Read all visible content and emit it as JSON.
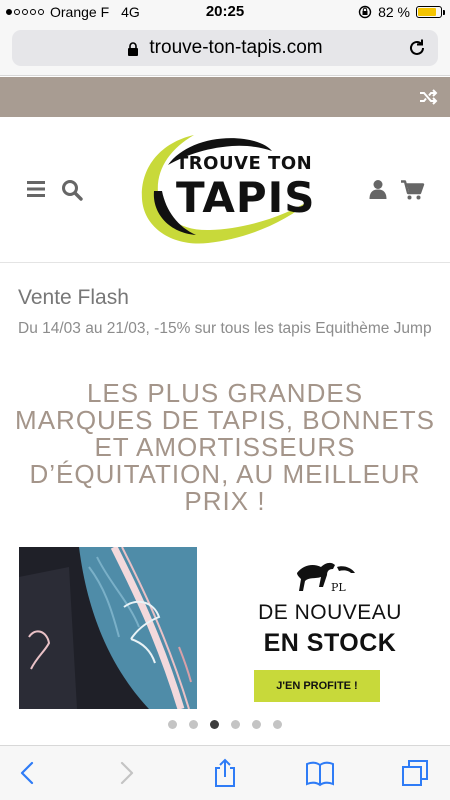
{
  "status_bar": {
    "carrier": "Orange F",
    "network": "4G",
    "time": "20:25",
    "battery": "82 %",
    "battery_level": 0.82
  },
  "browser": {
    "url": "trouve-ton-tapis.com"
  },
  "header": {
    "logo_line1": "TROUVE TON",
    "logo_line2": "TAPIS"
  },
  "flash_sale": {
    "title": "Vente Flash",
    "text": "Du 14/03 au 21/03, -15% sur tous les tapis Equithème Jump"
  },
  "headline": "LES PLUS GRANDES MARQUES DE TAPIS, BONNETS ET AMORTISSEURS D’ÉQUITATION, AU MEILLEUR PRIX !",
  "banner": {
    "line1": "DE NOUVEAU",
    "line2": "EN STOCK",
    "cta": "J'EN PROFITE !"
  },
  "carousel": {
    "count": 6,
    "active_index": 2
  },
  "colors": {
    "accent_green": "#c8d93a",
    "taupe": "#a89c92",
    "ios_blue": "#2f7cf6"
  }
}
